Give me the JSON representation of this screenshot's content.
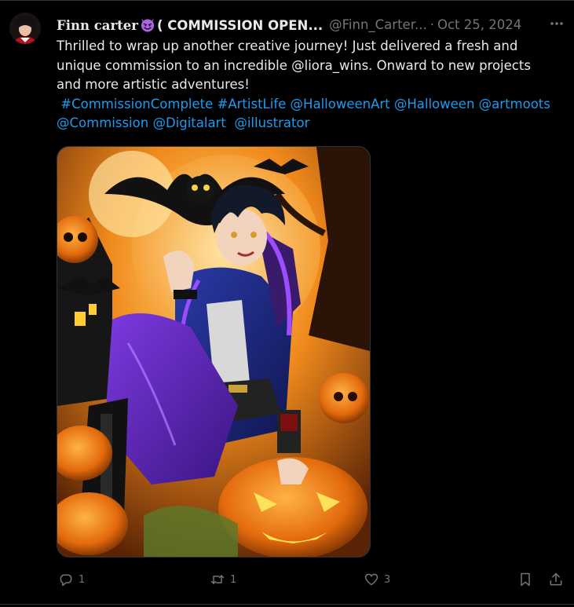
{
  "tweet": {
    "author": {
      "name_stylized": "Finn carter",
      "name_rest": "( COMMISSION OPEN...",
      "emoji": "smiling-devil",
      "handle": "@Finn_Carter...",
      "separator": "·",
      "date": "Oct 25, 2024"
    },
    "more_icon": "more-horizontal-icon",
    "text_line1": "Thrilled to wrap up another creative journey! Just delivered a fresh and unique commission to an incredible @liora_wins. Onward to new projects and more artistic adventures!",
    "tags": [
      "#CommissionComplete",
      "#ArtistLife",
      "@HalloweenArt",
      "@Halloween",
      "@artmoots",
      "@Commission",
      "@Digitalart",
      "@illustrator"
    ],
    "media": {
      "description_icon": "halloween-illustration",
      "accent_colors": [
        "#f28a1e",
        "#6a2dc8",
        "#1e2a7a",
        "#111111"
      ]
    },
    "actions": {
      "reply_count": "1",
      "retweet_count": "1",
      "like_count": "3",
      "reply_icon": "reply-icon",
      "retweet_icon": "retweet-icon",
      "like_icon": "heart-icon",
      "bookmark_icon": "bookmark-icon",
      "share_icon": "share-icon"
    }
  },
  "colors": {
    "background": "#000000",
    "text": "#e7e9ea",
    "muted": "#71767b",
    "link": "#1d9bf0"
  }
}
